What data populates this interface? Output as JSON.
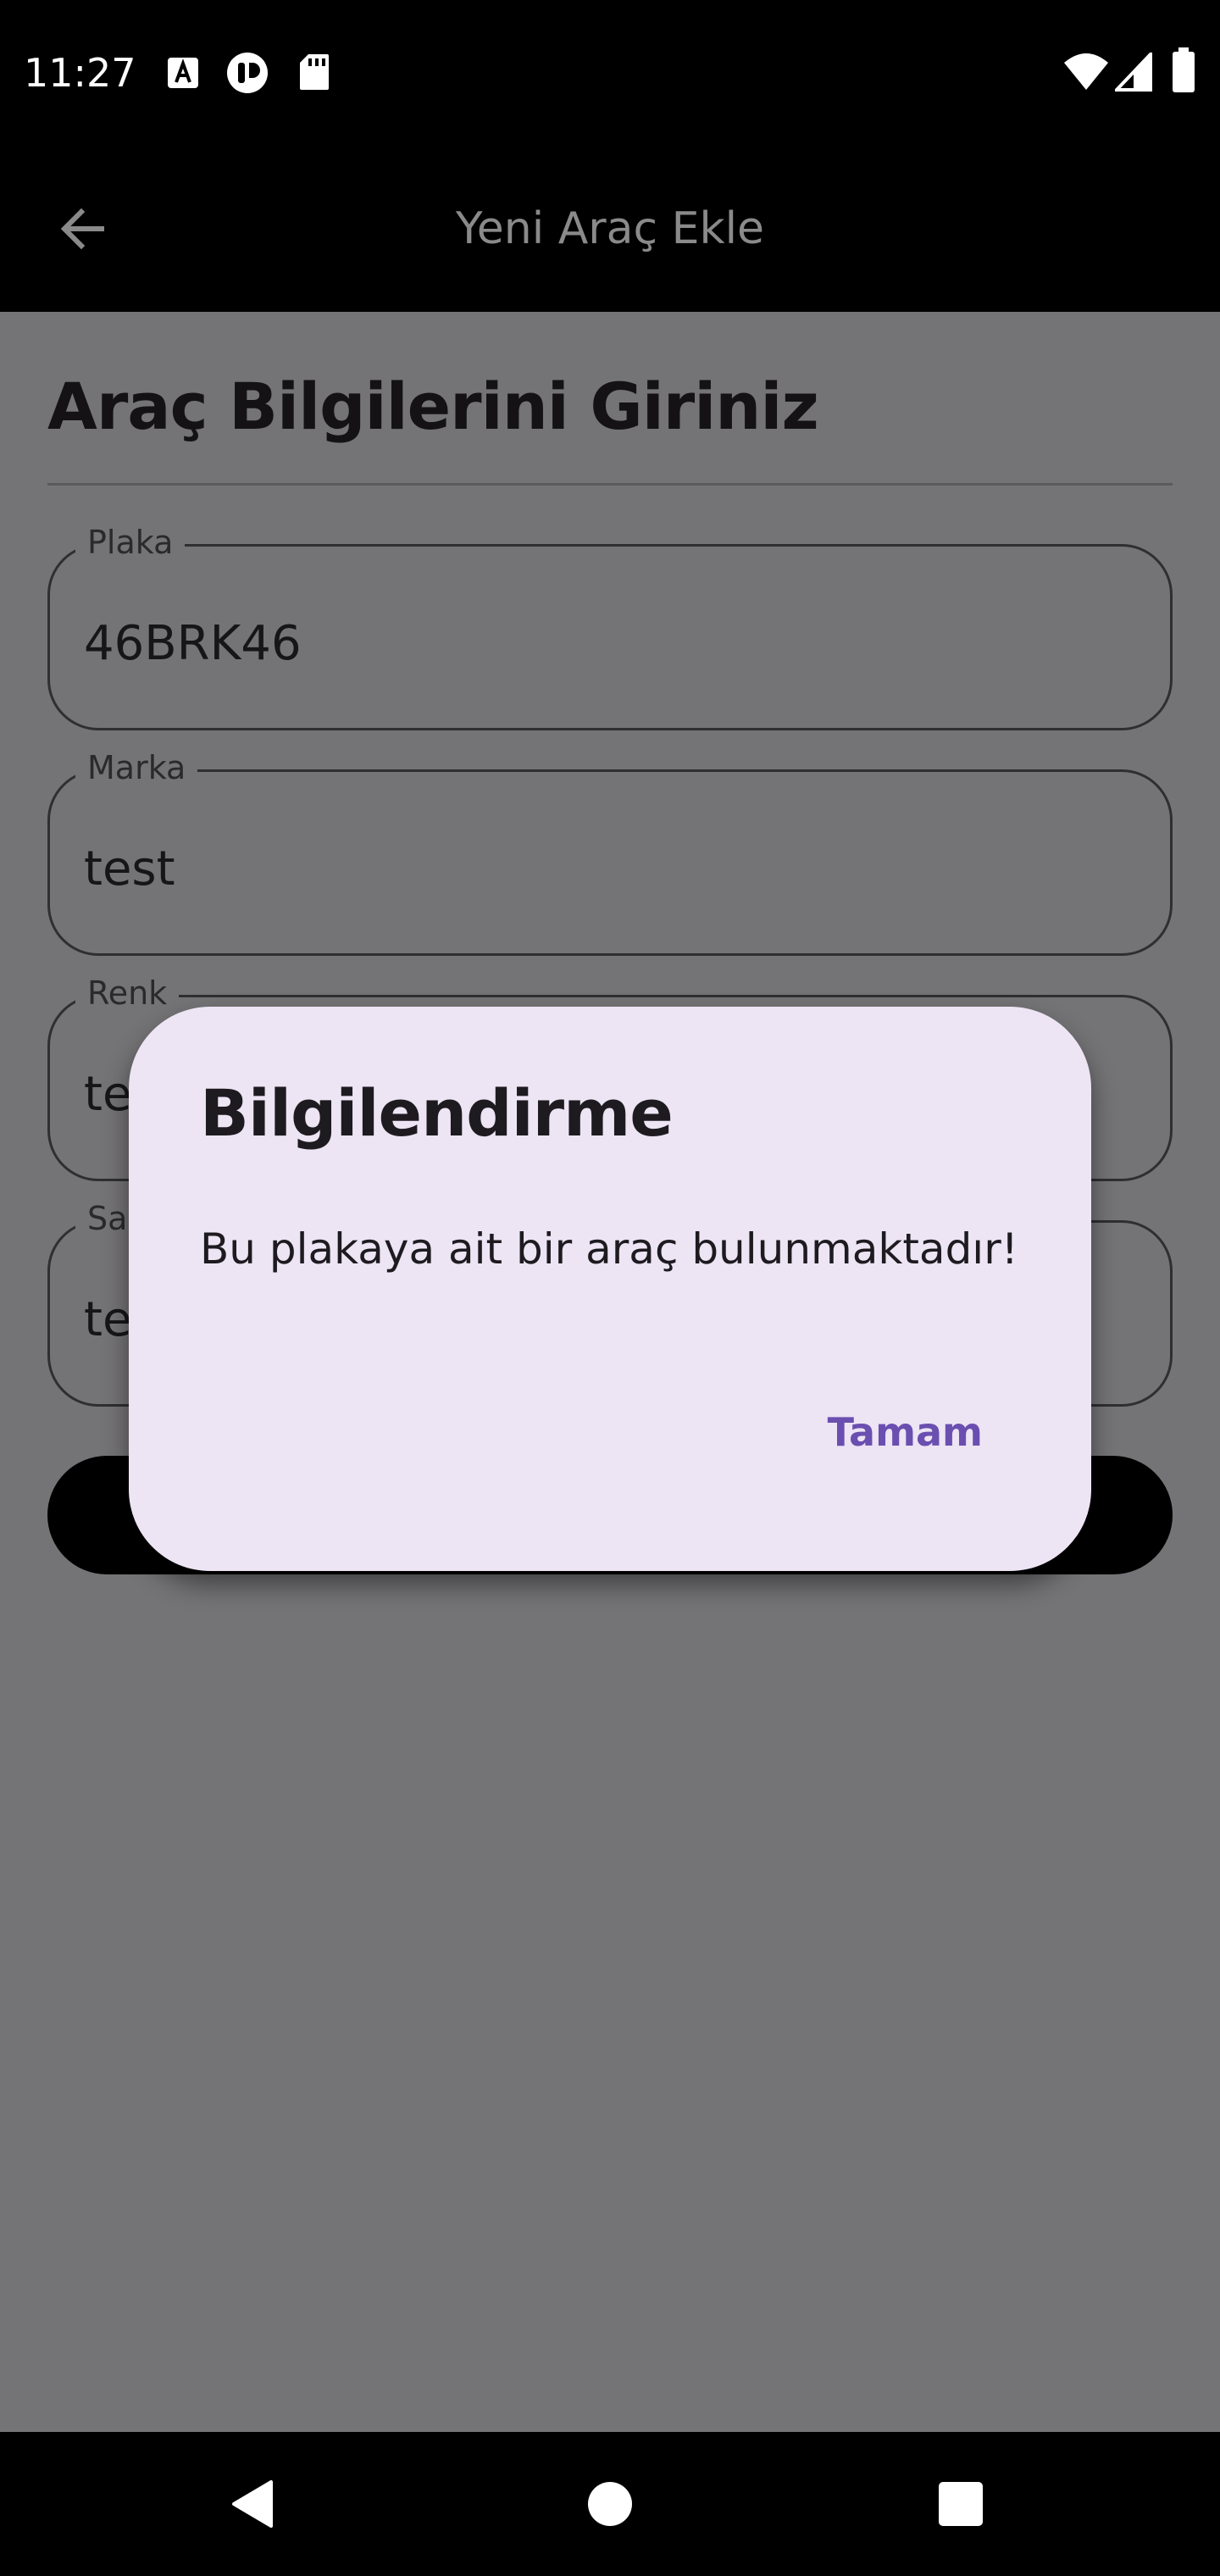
{
  "status_bar": {
    "time": "11:27",
    "left_icons": [
      "keyboard-a-icon",
      "accessibility-icon",
      "sd-card-icon"
    ],
    "right_icons": [
      "wifi-icon",
      "cell-signal-icon",
      "battery-icon"
    ]
  },
  "app_bar": {
    "title": "Yeni Araç Ekle",
    "back_icon": "arrow-left-icon"
  },
  "form": {
    "heading": "Araç Bilgilerini Giriniz",
    "fields": [
      {
        "label": "Plaka",
        "value": "46BRK46"
      },
      {
        "label": "Marka",
        "value": "test"
      },
      {
        "label": "Renk",
        "value": "te"
      },
      {
        "label": "Sa",
        "value": "te"
      }
    ]
  },
  "dialog": {
    "title": "Bilgilendirme",
    "message": "Bu plakaya ait bir araç bulunmaktadır!",
    "ok_label": "Tamam"
  },
  "nav_bar": {
    "icons": [
      "back-triangle-icon",
      "home-circle-icon",
      "recents-square-icon"
    ]
  },
  "colors": {
    "scrim_background": "#747375",
    "dialog_background": "#ede4f4",
    "dialog_action": "#6a4fb0",
    "bars": "#000000"
  }
}
